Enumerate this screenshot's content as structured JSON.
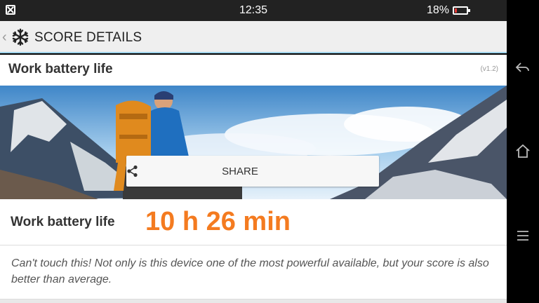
{
  "status": {
    "time": "12:35",
    "battery_pct": "18%",
    "battery_level": 0.18
  },
  "header": {
    "title": "SCORE DETAILS"
  },
  "section": {
    "name": "Work battery life",
    "version": "(v1.2)"
  },
  "share": {
    "label": "SHARE"
  },
  "score": {
    "label": "Work battery life",
    "value": "10 h 26 min"
  },
  "description": "Can't touch this! Not only is this device one of the most powerful available, but your score is also better than average.",
  "colors": {
    "accent": "#f47b20",
    "header_border": "#9fd3ea",
    "battery_low": "#e53935"
  }
}
